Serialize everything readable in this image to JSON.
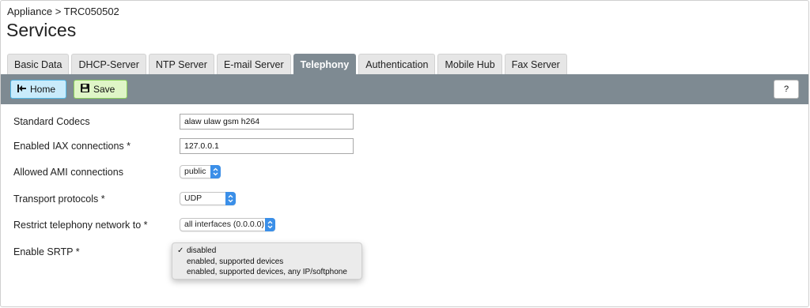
{
  "breadcrumb": "Appliance > TRC050502",
  "title": "Services",
  "tabs": [
    {
      "label": "Basic Data",
      "active": false
    },
    {
      "label": "DHCP-Server",
      "active": false
    },
    {
      "label": "NTP Server",
      "active": false
    },
    {
      "label": "E-mail Server",
      "active": false
    },
    {
      "label": "Telephony",
      "active": true
    },
    {
      "label": "Authentication",
      "active": false
    },
    {
      "label": "Mobile Hub",
      "active": false
    },
    {
      "label": "Fax Server",
      "active": false
    }
  ],
  "toolbar": {
    "home_label": "Home",
    "save_label": "Save",
    "help_label": "?",
    "home_icon": "home-first-icon",
    "save_icon": "floppy-disk-icon"
  },
  "form": {
    "codecs": {
      "label": "Standard Codecs",
      "value": "alaw ulaw gsm h264"
    },
    "iax": {
      "label": "Enabled IAX connections *",
      "value": "127.0.0.1"
    },
    "ami": {
      "label": "Allowed AMI connections",
      "value": "public"
    },
    "transport": {
      "label": "Transport protocols *",
      "value": "UDP"
    },
    "restrict": {
      "label": "Restrict telephony network to *",
      "value": "all interfaces (0.0.0.0)"
    },
    "srtp": {
      "label": "Enable SRTP *",
      "options": [
        "disabled",
        "enabled, supported devices",
        "enabled, supported devices, any IP/softphone"
      ],
      "selected": "disabled"
    }
  },
  "colors": {
    "toolbar": "#7e8a92",
    "active_tab": "#7e8a92",
    "home_button": "#c9ebfb",
    "save_button": "#dff5c7",
    "select_stepper": "#3b8fe8"
  }
}
